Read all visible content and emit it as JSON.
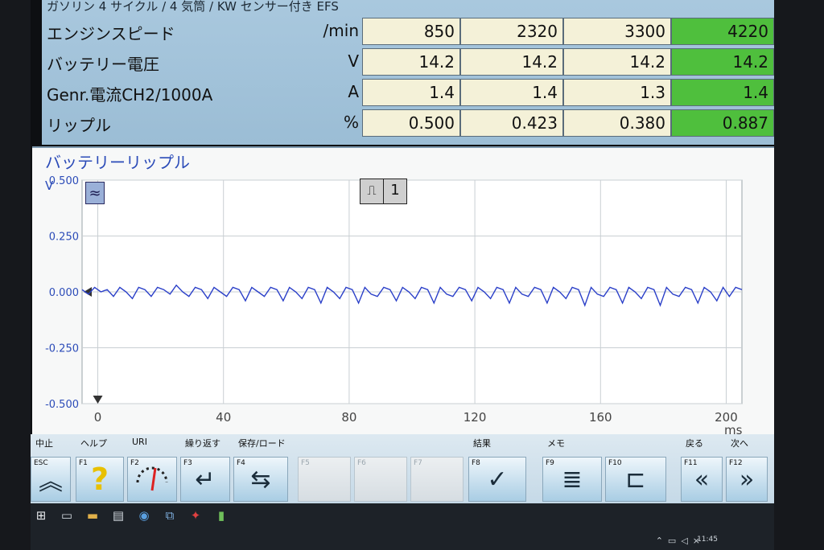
{
  "header": {
    "title": "ガソリン 4 サイクル / 4 気筒 / KW センサー付き EFS"
  },
  "measurements": [
    {
      "label": "エンジンスピード",
      "unit": "/min",
      "values": [
        "850",
        "2320",
        "3300",
        "4220"
      ]
    },
    {
      "label": "バッテリー電圧",
      "unit": "V",
      "values": [
        "14.2",
        "14.2",
        "14.2",
        "14.2"
      ]
    },
    {
      "label": "Genr.電流CH2/1000A",
      "unit": "A",
      "values": [
        "1.4",
        "1.4",
        "1.3",
        "1.4"
      ]
    },
    {
      "label": "リップル",
      "unit": "%",
      "values": [
        "0.500",
        "0.423",
        "0.380",
        "0.887"
      ]
    }
  ],
  "chart": {
    "title": "バッテリーリップル",
    "trigger_channel": "1",
    "mode_icon": "ac-wave-icon",
    "trigger_icon": "rising-edge-trigger-icon"
  },
  "chart_data": {
    "type": "line",
    "title": "バッテリーリップル",
    "ylabel": "V",
    "xlabel": "ms",
    "xlim": [
      -5,
      205
    ],
    "ylim": [
      -0.5,
      0.5
    ],
    "x_ticks": [
      "0",
      "40",
      "80",
      "120",
      "160",
      "200"
    ],
    "y_ticks": [
      "0.500",
      "0.250",
      "0.000",
      "-0.250",
      "-0.500"
    ],
    "grid": true,
    "series": [
      {
        "color": "#2a3fc8",
        "x": [
          -5,
          -3,
          -1,
          1,
          3,
          5,
          7,
          9,
          11,
          13,
          15,
          17,
          19,
          21,
          23,
          25,
          27,
          29,
          31,
          33,
          35,
          37,
          39,
          41,
          43,
          45,
          47,
          49,
          51,
          53,
          55,
          57,
          59,
          61,
          63,
          65,
          67,
          69,
          71,
          73,
          75,
          77,
          79,
          81,
          83,
          85,
          87,
          89,
          91,
          93,
          95,
          97,
          99,
          101,
          103,
          105,
          107,
          109,
          111,
          113,
          115,
          117,
          119,
          121,
          123,
          125,
          127,
          129,
          131,
          133,
          135,
          137,
          139,
          141,
          143,
          145,
          147,
          149,
          151,
          153,
          155,
          157,
          159,
          161,
          163,
          165,
          167,
          169,
          171,
          173,
          175,
          177,
          179,
          181,
          183,
          185,
          187,
          189,
          191,
          193,
          195,
          197,
          199,
          201,
          203,
          205
        ],
        "y": [
          0.01,
          -0.01,
          0.02,
          0.0,
          0.01,
          -0.02,
          0.02,
          0.0,
          -0.03,
          0.02,
          0.01,
          -0.02,
          0.02,
          0.01,
          -0.01,
          0.03,
          0.0,
          -0.02,
          0.02,
          0.01,
          -0.03,
          0.02,
          0.0,
          -0.02,
          0.02,
          0.01,
          -0.04,
          0.02,
          0.0,
          -0.02,
          0.02,
          0.01,
          -0.04,
          0.02,
          0.0,
          -0.03,
          0.02,
          0.01,
          -0.05,
          0.02,
          0.0,
          -0.03,
          0.02,
          0.01,
          -0.05,
          0.02,
          -0.01,
          -0.02,
          0.02,
          0.01,
          -0.04,
          0.02,
          0.0,
          -0.03,
          0.02,
          0.01,
          -0.05,
          0.02,
          -0.01,
          -0.02,
          0.02,
          0.01,
          -0.04,
          0.02,
          0.0,
          -0.03,
          0.02,
          0.01,
          -0.05,
          0.02,
          -0.01,
          -0.02,
          0.02,
          0.01,
          -0.05,
          0.02,
          0.0,
          -0.03,
          0.02,
          0.01,
          -0.06,
          0.02,
          -0.01,
          -0.02,
          0.02,
          0.01,
          -0.05,
          0.02,
          0.0,
          -0.03,
          0.02,
          0.01,
          -0.06,
          0.02,
          -0.01,
          -0.02,
          0.02,
          0.01,
          -0.05,
          0.02,
          0.0,
          -0.04,
          0.02,
          -0.02,
          0.02,
          0.01
        ]
      }
    ]
  },
  "function_keys": [
    {
      "key": "ESC",
      "label": "中止",
      "icon": "double-chevron-up-icon",
      "glyph": "︽",
      "enabled": true
    },
    {
      "key": "F1",
      "label": "ヘルプ",
      "icon": "question-mark-icon",
      "glyph": "?",
      "enabled": true
    },
    {
      "key": "F2",
      "label": "URI",
      "icon": "gauge-icon",
      "glyph": "",
      "enabled": true
    },
    {
      "key": "F3",
      "label": "繰り返す",
      "icon": "repeat-arrow-icon",
      "glyph": "↵",
      "enabled": true
    },
    {
      "key": "F4",
      "label": "保存/ロード",
      "icon": "save-load-arrows-icon",
      "glyph": "⇆",
      "enabled": true
    },
    {
      "key": "F5",
      "label": "",
      "icon": "",
      "glyph": "",
      "enabled": false
    },
    {
      "key": "F6",
      "label": "",
      "icon": "",
      "glyph": "",
      "enabled": false
    },
    {
      "key": "F7",
      "label": "",
      "icon": "",
      "glyph": "",
      "enabled": false
    },
    {
      "key": "F8",
      "label": "結果",
      "icon": "results-print-icon",
      "glyph": "✓",
      "enabled": true
    },
    {
      "key": "F9",
      "label": "メモ",
      "icon": "memo-document-icon",
      "glyph": "≣",
      "enabled": true
    },
    {
      "key": "F10",
      "label": "F10",
      "icon": "tree-structure-icon",
      "glyph": "⊏",
      "enabled": true
    },
    {
      "key": "F11",
      "label": "戻る",
      "icon": "double-chevron-left-icon",
      "glyph": "«",
      "enabled": true
    },
    {
      "key": "F12",
      "label": "次へ",
      "icon": "double-chevron-right-icon",
      "glyph": "»",
      "enabled": true
    }
  ],
  "taskbar": {
    "time": "11:45",
    "icons": [
      "windows-start-icon",
      "task-view-icon",
      "file-explorer-icon",
      "document-app-icon",
      "disc-app-icon",
      "remote-app-icon",
      "pdf-app-icon",
      "battery-app-icon"
    ]
  },
  "colors": {
    "table_bg": "#a9c8de",
    "cell_bg": "#f4f1d8",
    "highlight": "#4fbf3d",
    "trace": "#2a3fc8",
    "title_blue": "#2b4bb8"
  }
}
